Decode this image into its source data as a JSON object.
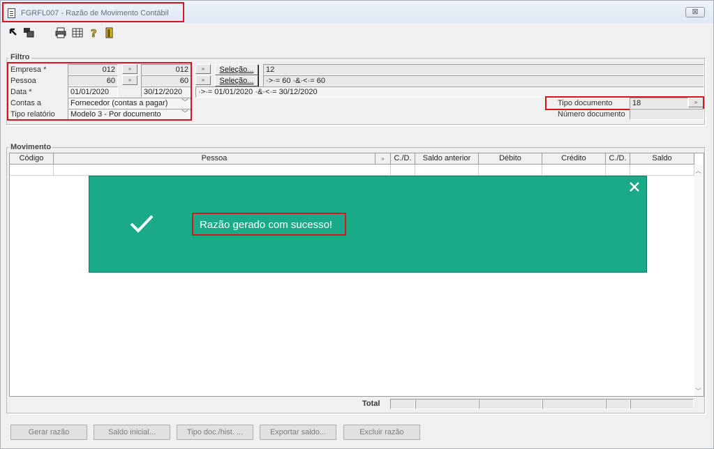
{
  "window": {
    "title": "FGRFL007 - Razão de Movimento Contábil",
    "close_label": "⊠"
  },
  "toolbar": {
    "icons": [
      "export-arrow-icon",
      "copy-window-icon",
      "print-icon",
      "grid-table-icon",
      "help-icon",
      "exit-door-icon"
    ]
  },
  "filtro": {
    "group_label": "Filtro",
    "empresa": {
      "label": "Empresa *",
      "from": "012",
      "to": "012",
      "selection_label": "Seleção...",
      "selection_value": "12"
    },
    "pessoa": {
      "label": "Pessoa",
      "from": "60",
      "to": "60",
      "selection_label": "Seleção...",
      "selection_value": "·>·= 60 ·&·<·= 60"
    },
    "data": {
      "label": "Data *",
      "from": "01/01/2020",
      "to": "30/12/2020",
      "selection_value": "·>·= 01/01/2020 ·&·<·= 30/12/2020"
    },
    "contas_a": {
      "label": "Contas a",
      "value": "Fornecedor (contas a pagar)"
    },
    "tipo_relatorio": {
      "label": "Tipo relatório",
      "value": "Modelo 3 - Por documento"
    },
    "tipo_documento": {
      "label": "Tipo documento",
      "value": "18"
    },
    "numero_documento": {
      "label": "Número documento",
      "value": ""
    }
  },
  "movimento": {
    "group_label": "Movimento",
    "columns": [
      "Código",
      "Pessoa",
      "",
      "C./D.",
      "Saldo anterior",
      "Débito",
      "Crédito",
      "C./D.",
      "Saldo"
    ],
    "total_label": "Total"
  },
  "buttons": {
    "gerar_razao": "Gerar razão",
    "saldo_inicial": "Saldo inicial...",
    "tipo_doc_hist": "Tipo doc./hist. ...",
    "exportar_saldo": "Exportar saldo...",
    "excluir_razao": "Excluir razão"
  },
  "toast": {
    "message": "Razão gerado com sucesso!",
    "background_color": "#1aaa88"
  }
}
